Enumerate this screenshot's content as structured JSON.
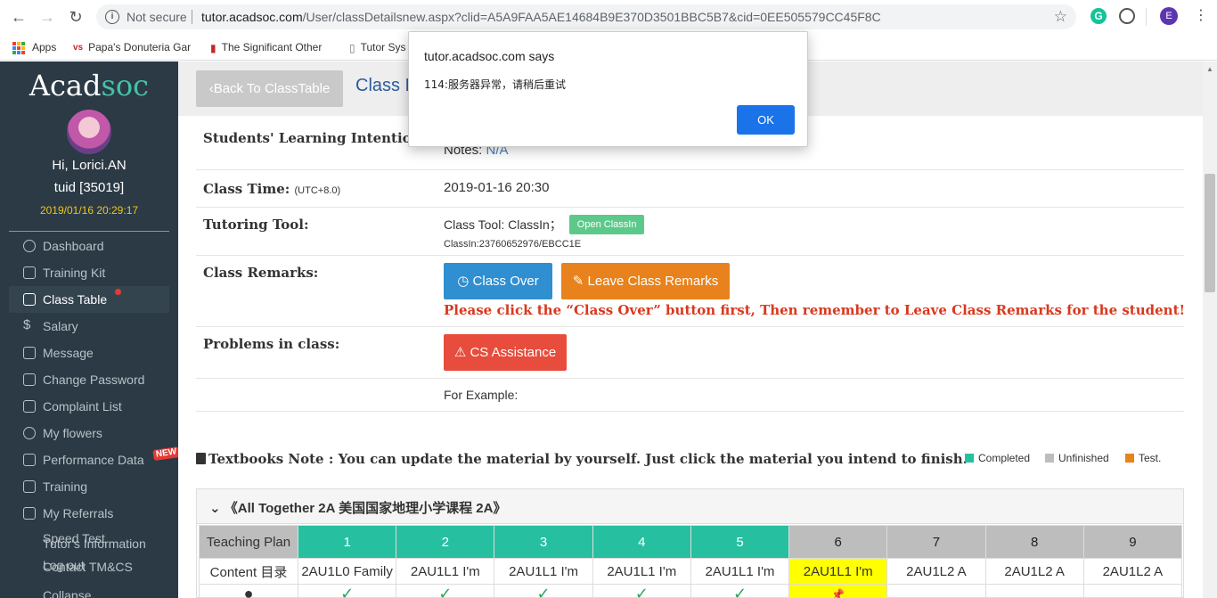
{
  "browser": {
    "not_secure": "Not secure",
    "url_host": "tutor.acadsoc.com",
    "url_path": "/User/classDetailsnew.aspx?clid=A5A9FAA5AE14684B9E370D3501BBC5B7&cid=0EE505579CC45F8C",
    "profile_initial": "E",
    "grammarly_initial": "G",
    "bookmarks": [
      {
        "label": "Apps"
      },
      {
        "label": "Papa's Donuteria Gar"
      },
      {
        "label": "The Significant Other"
      },
      {
        "label": "Tutor Sys"
      }
    ]
  },
  "sidebar": {
    "logo_a": "Acad",
    "logo_b": "soc",
    "greeting": "Hi, Lorici.AN",
    "tuid": "tuid [35019]",
    "datetime": "2019/01/16 20:29:17",
    "items": [
      {
        "label": "Dashboard"
      },
      {
        "label": "Training Kit"
      },
      {
        "label": "Class Table"
      },
      {
        "label": "Salary"
      },
      {
        "label": "Message"
      },
      {
        "label": "Change Password"
      },
      {
        "label": "Complaint List"
      },
      {
        "label": "My flowers"
      },
      {
        "label": "Performance Data"
      },
      {
        "label": "Training"
      },
      {
        "label": "My Referrals"
      }
    ],
    "new_badge": "NEW",
    "overlap": {
      "speed_test": "Speed Test",
      "tutors_info": "Tutor's Information",
      "log_out": "Log out",
      "contact": "Contact TM&CS",
      "collapse": "Collapse"
    }
  },
  "header": {
    "back_label": "Back To ClassTable",
    "title": "Class D"
  },
  "details": {
    "learning_intention_label": "Students' Learning Intention:",
    "notes_prefix": "Notes: ",
    "notes_value": "N/A",
    "class_time_label": "Class Time:",
    "class_time_tz": "(UTC+8.0)",
    "class_time_value": "2019-01-16 20:30",
    "tool_label": "Tutoring Tool:",
    "tool_value": "Class Tool: ClassIn；",
    "open_classin": "Open ClassIn",
    "classin_id": "ClassIn:23760652976/EBCC1E",
    "remarks_label": "Class Remarks:",
    "class_over": "Class Over",
    "leave_remarks": "Leave Class Remarks",
    "warning": "Please click the “Class Over” button first, Then remember to Leave Class Remarks for the student!",
    "problems_label": "Problems in class:",
    "cs_assist": "CS Assistance",
    "for_example": "For Example:"
  },
  "textbooks": {
    "note": "Textbooks Note : You can update the material by yourself. Just click the material you intend to finish.",
    "legend": [
      {
        "label": "Completed",
        "color": "#26bfa0"
      },
      {
        "label": "Unfinished",
        "color": "#bdbdbd"
      },
      {
        "label": "Test.",
        "color": "#e8821c"
      }
    ],
    "course_title": "《All Together 2A 美国国家地理小学课程 2A》",
    "plan_label": "Teaching Plan",
    "content_label": "Content 目录",
    "lessons": [
      {
        "num": "1",
        "content": "2AU1L0 Family",
        "status": "done"
      },
      {
        "num": "2",
        "content": "2AU1L1 I'm",
        "status": "done"
      },
      {
        "num": "3",
        "content": "2AU1L1 I'm",
        "status": "done"
      },
      {
        "num": "4",
        "content": "2AU1L1 I'm",
        "status": "done"
      },
      {
        "num": "5",
        "content": "2AU1L1 I'm",
        "status": "done"
      },
      {
        "num": "6",
        "content": "2AU1L1 I'm",
        "status": "current"
      },
      {
        "num": "7",
        "content": "2AU1L2 A",
        "status": "pending"
      },
      {
        "num": "8",
        "content": "2AU1L2 A",
        "status": "pending"
      },
      {
        "num": "9",
        "content": "2AU1L2 A",
        "status": "pending"
      }
    ],
    "check_mark": "✓",
    "pin_mark": "📌"
  },
  "dialog": {
    "title": "tutor.acadsoc.com says",
    "message": "114:服务器异常，请稍后重试",
    "ok": "OK"
  }
}
